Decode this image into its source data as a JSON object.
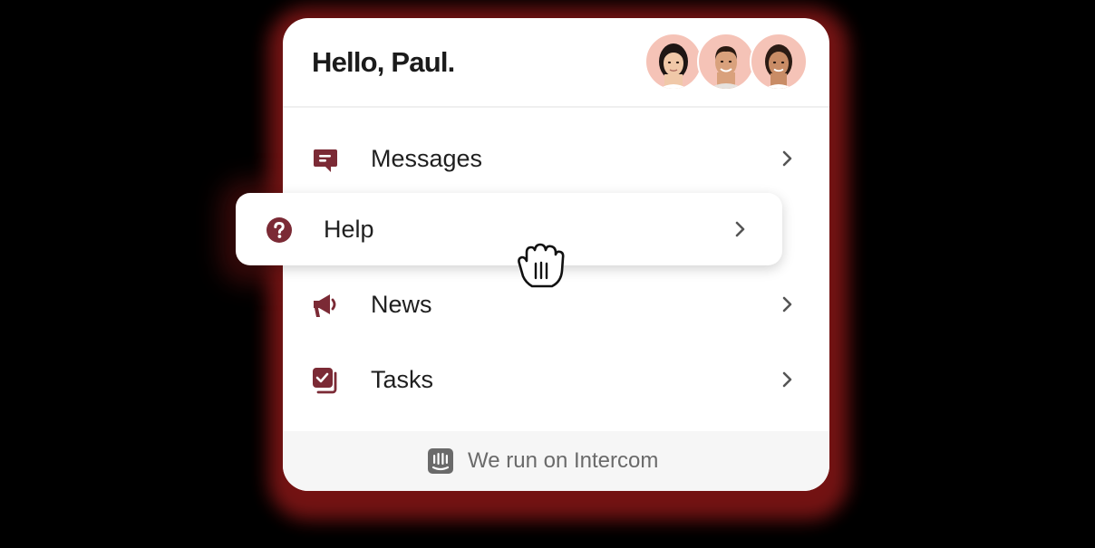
{
  "header": {
    "greeting": "Hello, Paul.",
    "avatars": [
      {
        "name": "avatar-woman-1",
        "skin": "#f0c8a8",
        "hair": "#1e1614"
      },
      {
        "name": "avatar-man",
        "skin": "#d9a17c",
        "hair": "#2a1a12"
      },
      {
        "name": "avatar-woman-2",
        "skin": "#c98c66",
        "hair": "#2b1b14"
      }
    ]
  },
  "menu": {
    "items": [
      {
        "id": "messages",
        "label": "Messages",
        "icon": "message-icon"
      },
      {
        "id": "help",
        "label": "Help",
        "icon": "question-circle-icon"
      },
      {
        "id": "news",
        "label": "News",
        "icon": "megaphone-icon"
      },
      {
        "id": "tasks",
        "label": "Tasks",
        "icon": "task-checklist-icon"
      }
    ]
  },
  "footer": {
    "text": "We run on Intercom",
    "icon": "intercom-logo-icon"
  },
  "cursor": {
    "icon": "grab-hand-cursor-icon"
  },
  "colors": {
    "accent": "#7b2a35",
    "background": "#000000",
    "glow": "#7a1414",
    "panel": "#ffffff",
    "footer_bg": "#f6f6f6",
    "avatar_bg": "#f5c3b7",
    "chevron": "#555555"
  }
}
